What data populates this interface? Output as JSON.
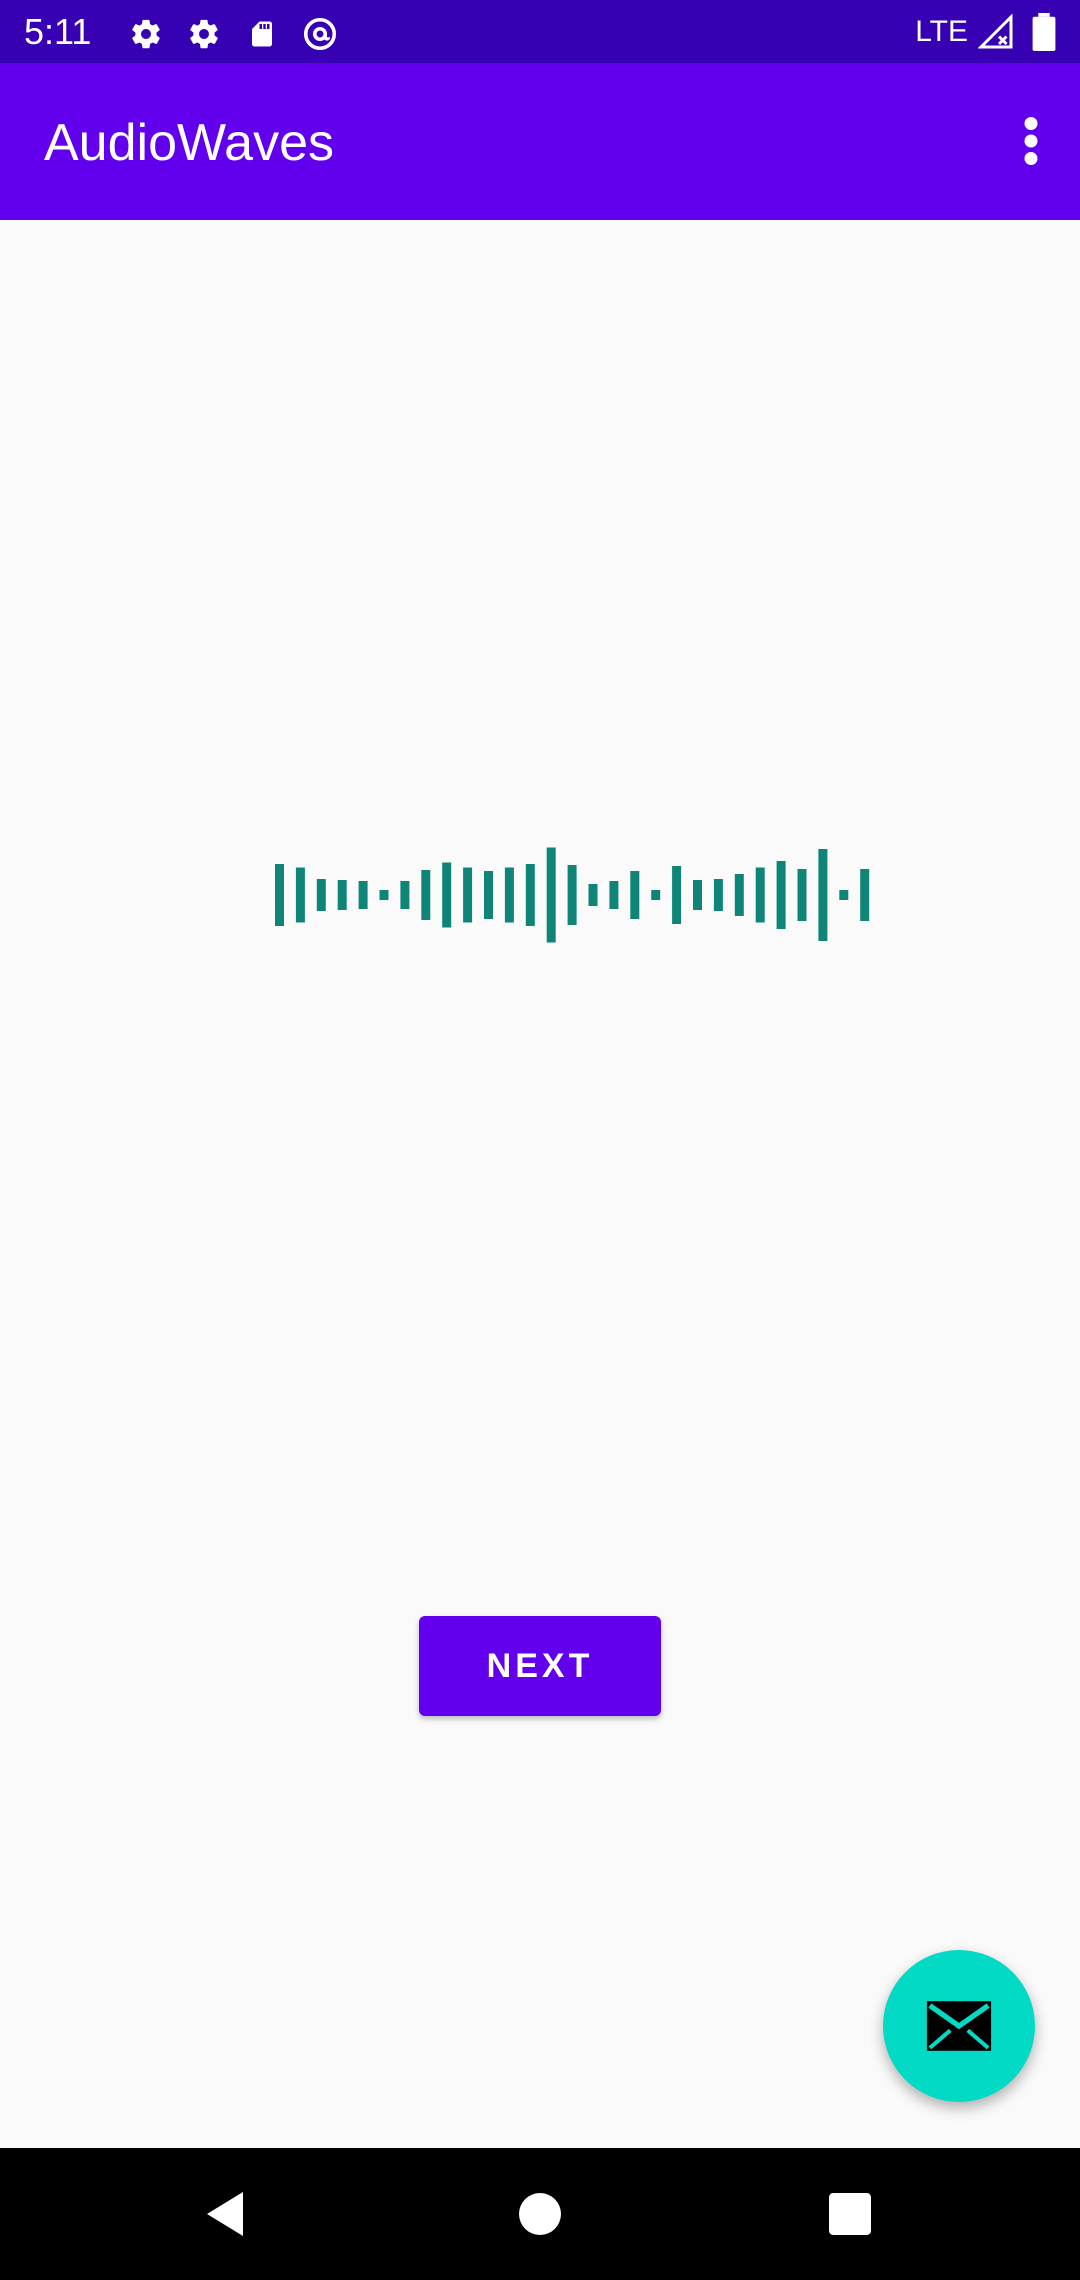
{
  "status_bar": {
    "time": "5:11",
    "network": "LTE",
    "left_icons": [
      "settings-icon",
      "settings-icon",
      "sd-card-icon",
      "at-sign-icon"
    ],
    "right_icons": [
      "signal-icon",
      "battery-icon"
    ]
  },
  "app_bar": {
    "title": "AudioWaves",
    "menu_icon": "more-vert-icon"
  },
  "waveform": {
    "color": "#0e8577",
    "levels": [
      0.62,
      0.55,
      0.32,
      0.3,
      0.28,
      0.1,
      0.28,
      0.5,
      0.65,
      0.55,
      0.48,
      0.55,
      0.62,
      0.95,
      0.6,
      0.22,
      0.28,
      0.48,
      0.1,
      0.58,
      0.3,
      0.32,
      0.42,
      0.55,
      0.68,
      0.52,
      0.92,
      0.1,
      0.52
    ]
  },
  "next_button": {
    "label": "NEXT"
  },
  "fab": {
    "icon": "email-icon",
    "color": "#03dac5"
  },
  "nav_bar": {
    "buttons": [
      "back-icon",
      "home-icon",
      "recents-icon"
    ]
  },
  "colors": {
    "primary": "#6200ee",
    "primary_dark": "#3700b3",
    "secondary": "#03dac5",
    "background": "#fafafa"
  }
}
